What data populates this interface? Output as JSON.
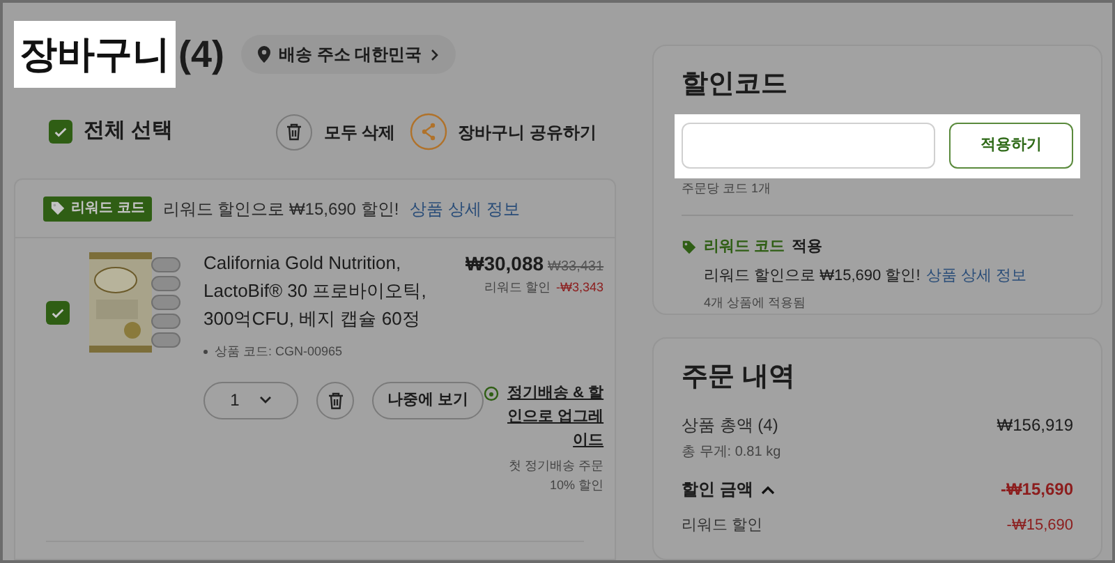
{
  "cart": {
    "title": "장바구니",
    "highlighted": true,
    "count": "(4)",
    "shipping": "배송 주소 대한민국"
  },
  "toolbar": {
    "select_all": {
      "label": "전체 선택",
      "checked": true
    },
    "delete_all": "모두 삭제",
    "share": "장바구니 공유하기"
  },
  "promo_banner": {
    "tag": "리워드 코드",
    "text": "리워드 할인으로 ₩15,690 할인!",
    "link": "상품 상세 정보"
  },
  "item": {
    "checked": true,
    "name": "California Gold Nutrition, LactoBif® 30 프로바이오틱, 300억CFU, 베지 캡슐 60정",
    "price": "₩30,088",
    "original_price": "₩33,431",
    "discount_label": "리워드 할인",
    "discount": "-₩3,343",
    "code": "상품 코드: CGN-00965",
    "quantity": "1",
    "save_later": "나중에 보기",
    "subscribe_link": "정기배송 & 할인으로 업그레이드",
    "subscribe_note": "첫 정기배송 주문 10% 할인"
  },
  "coupon": {
    "title": "할인코드",
    "highlighted": true,
    "button": "적용하기",
    "note": "주문당 코드 1개"
  },
  "applied": {
    "tag": "리워드 코드",
    "status": "적용",
    "text": "리워드 할인으로 ₩15,690 할인!",
    "link": "상품 상세 정보",
    "note": "4개 상품에 적용됨"
  },
  "summary": {
    "title": "주문 내역",
    "rows": [
      {
        "kind": "total",
        "label": "상품 총액 (4)",
        "value": "₩156,919"
      },
      {
        "kind": "note",
        "label": "총 무게: 0.81 kg"
      },
      {
        "kind": "group",
        "label": "할인 금액",
        "expanded": true,
        "value": "-₩15,690"
      },
      {
        "kind": "discount",
        "label": "리워드 할인",
        "value": "-₩15,690"
      }
    ]
  }
}
